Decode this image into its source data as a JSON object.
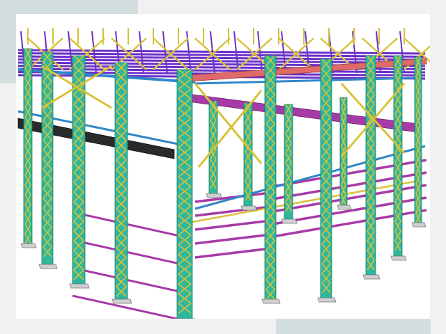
{
  "image": {
    "subject": "steel-frame-3d-model",
    "palette": {
      "column": "#2fb79c",
      "column_edge": "#1d7f6a",
      "brace": "#d8c23a",
      "brace_edge": "#8f7f12",
      "roof_beam": "#6a2fc8",
      "rafter": "#e06a6a",
      "girt": "#a83aa8",
      "tie_blue": "#2f86c8",
      "walkway": "#2a2a2a",
      "plate": "#cfcfcf"
    }
  }
}
